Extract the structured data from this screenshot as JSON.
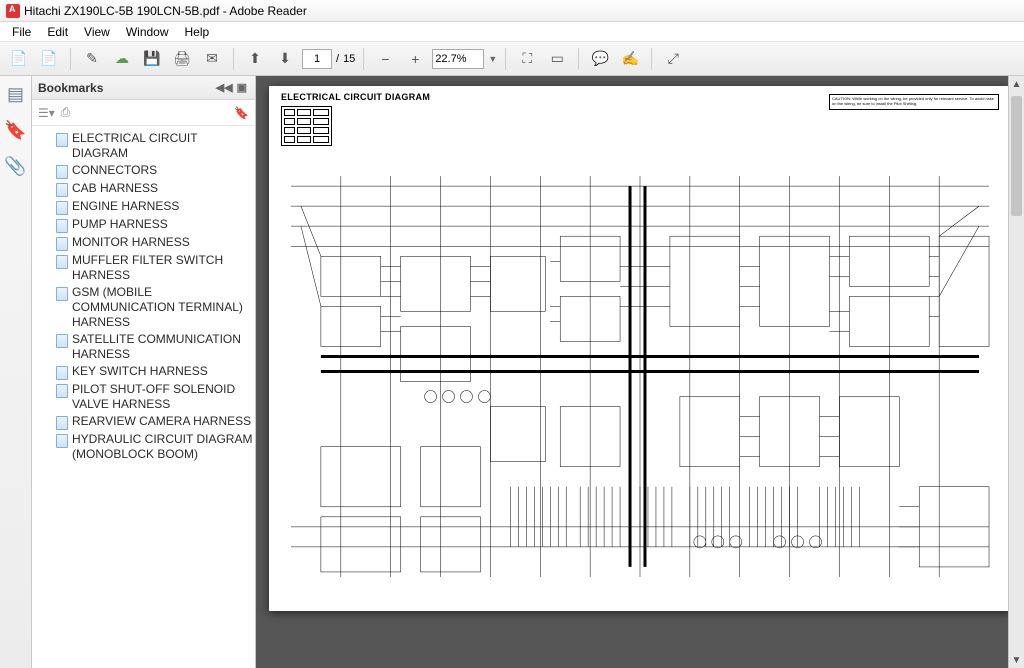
{
  "window": {
    "title": "Hitachi ZX190LC-5B 190LCN-5B.pdf - Adobe Reader"
  },
  "menu": {
    "items": [
      "File",
      "Edit",
      "View",
      "Window",
      "Help"
    ]
  },
  "toolbar": {
    "page_current": "1",
    "page_sep": "/",
    "page_total": "15",
    "zoom": "22.7%"
  },
  "bookmarks": {
    "title": "Bookmarks",
    "items": [
      "ELECTRICAL CIRCUIT DIAGRAM",
      "CONNECTORS",
      "CAB HARNESS",
      "ENGINE HARNESS",
      "PUMP HARNESS",
      "MONITOR HARNESS",
      "MUFFLER FILTER SWITCH HARNESS",
      "GSM (MOBILE COMMUNICATION TERMINAL) HARNESS",
      "SATELLITE COMMUNICATION HARNESS",
      "KEY SWITCH HARNESS",
      "PILOT SHUT-OFF SOLENOID VALVE HARNESS",
      "REARVIEW CAMERA HARNESS",
      "HYDRAULIC CIRCUIT DIAGRAM (MONOBLOCK BOOM)"
    ]
  },
  "document": {
    "page_heading": "ELECTRICAL CIRCUIT DIAGRAM",
    "caution_text": "CAUTION: While working on the wiring, be provided only for relevant service. To avoid risks on the wiring, be sure to install the Pilot Shifting."
  }
}
